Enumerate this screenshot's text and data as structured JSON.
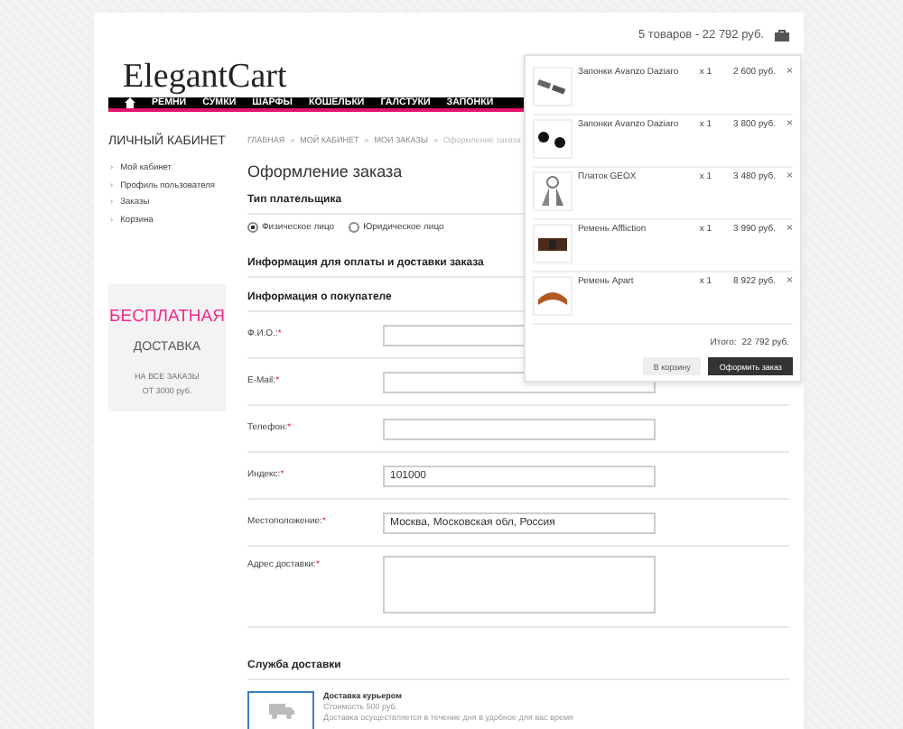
{
  "header": {
    "logo": "ElegantCart",
    "cart_summary": "5 товаров - 22 792 руб."
  },
  "nav": {
    "items": [
      "РЕМНИ",
      "СУМКИ",
      "ШАРФЫ",
      "КОШЕЛЬКИ",
      "ГАЛСТУКИ",
      "ЗАПОНКИ"
    ]
  },
  "sidebar": {
    "title": "ЛИЧНЫЙ КАБИНЕТ",
    "bullet": "›",
    "items": [
      "Мой кабинет",
      "Профиль пользователя",
      "Заказы",
      "Корзина"
    ]
  },
  "promo": {
    "headline": "БЕСПЛАТНАЯ",
    "subline": "ДОСТАВКА",
    "note_lines": [
      "НА ВСЕ ЗАКАЗЫ",
      "ОТ 3000 руб."
    ]
  },
  "breadcrumb": {
    "separator": "»",
    "items": [
      {
        "label": "ГЛАВНАЯ",
        "current": false
      },
      {
        "label": "МОЙ КАБИНЕТ",
        "current": false
      },
      {
        "label": "МОИ ЗАКАЗЫ",
        "current": false
      },
      {
        "label": "Оформление заказа",
        "current": true
      }
    ]
  },
  "title": "Оформление заказа",
  "payer_type": {
    "heading": "Тип плательщика",
    "options": [
      {
        "label": "Физическое лицо",
        "selected": true
      },
      {
        "label": "Юридическое лицо",
        "selected": false
      }
    ]
  },
  "section_heading": "Информация для оплаты и доставки заказа",
  "buyer": {
    "heading": "Информация о покупателе",
    "required_mark": "*",
    "fields": [
      {
        "label": "Ф.И.О.:",
        "required": true,
        "kind": "input"
      },
      {
        "label": "E-Mail:",
        "required": true,
        "kind": "input"
      },
      {
        "label": "Телефон:",
        "required": true,
        "kind": "input"
      },
      {
        "label": "Индекс:",
        "required": true,
        "kind": "input",
        "value": "101000"
      },
      {
        "label": "Местоположение:",
        "required": true,
        "kind": "input",
        "value": "Москва, Московская обл, Россия"
      },
      {
        "label": "Адрес доставки:",
        "required": true,
        "kind": "textarea"
      }
    ]
  },
  "delivery": {
    "heading": "Служба доставки",
    "options": [
      {
        "name": "Доставка курьером",
        "price": "Стоимость 500 руб.",
        "description": "Доставка осуществляется в течение дня в удобное для вас время",
        "selected": true
      }
    ]
  },
  "cart_dropdown": {
    "items": [
      {
        "name": "Запонки Avanzo Daziaro",
        "qty": "x 1",
        "price": "2 600 руб.",
        "remove": "×"
      },
      {
        "name": "Запонки Avanzo Daziaro",
        "qty": "x 1",
        "price": "3 800 руб.",
        "remove": "×"
      },
      {
        "name": "Платок GEOX",
        "qty": "x 1",
        "price": "3 480 руб.",
        "remove": "×"
      },
      {
        "name": "Ремень Affliction",
        "qty": "x 1",
        "price": "3 990 руб.",
        "remove": "×"
      },
      {
        "name": "Ремень Apart",
        "qty": "x 1",
        "price": "8 922 руб.",
        "remove": "×"
      }
    ],
    "total_label": "Итого:",
    "total": "22 792 руб.",
    "buttons": [
      {
        "label": "В корзину",
        "primary": false
      },
      {
        "label": "Оформить заказ",
        "primary": true
      }
    ]
  }
}
